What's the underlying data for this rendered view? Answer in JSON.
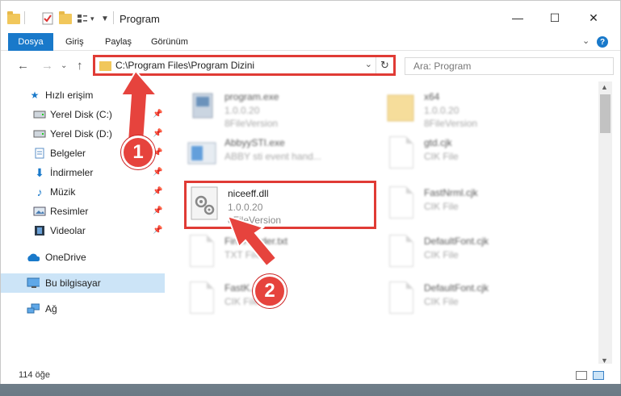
{
  "window": {
    "title": "Program",
    "controls": {
      "minimize": "—",
      "maximize": "☐",
      "close": "✕"
    }
  },
  "ribbon": {
    "tabs": [
      "Dosya",
      "Giriş",
      "Paylaş",
      "Görünüm"
    ],
    "collapse_icon": "chevron-down-icon",
    "help_label": "?"
  },
  "address": {
    "path": "C:\\Program Files\\Program Dizini",
    "search_placeholder": "Ara: Program"
  },
  "sidebar": {
    "items": [
      {
        "label": "Hızlı erişim",
        "icon": "star-icon"
      },
      {
        "label": "Yerel Disk (C:)",
        "icon": "drive-icon",
        "pinned": true
      },
      {
        "label": "Yerel Disk (D:)",
        "icon": "drive-icon",
        "pinned": true
      },
      {
        "label": "Belgeler",
        "icon": "documents-icon",
        "pinned": true
      },
      {
        "label": "İndirmeler",
        "icon": "download-icon",
        "pinned": true
      },
      {
        "label": "Müzik",
        "icon": "music-icon",
        "pinned": true
      },
      {
        "label": "Resimler",
        "icon": "pictures-icon",
        "pinned": true
      },
      {
        "label": "Videolar",
        "icon": "videos-icon",
        "pinned": true
      },
      {
        "label": "OneDrive",
        "icon": "cloud-icon"
      },
      {
        "label": "Bu bilgisayar",
        "icon": "computer-icon",
        "selected": true
      },
      {
        "label": "Ağ",
        "icon": "network-icon"
      }
    ]
  },
  "files": {
    "left": [
      {
        "name": "program.exe",
        "line1": "1.0.0.20",
        "line2": "8FileVersion",
        "blurred": true
      },
      {
        "name": "AbbyySTI.exe",
        "line1": "ABBY sti event hand...",
        "line2": "",
        "blurred": true
      },
      {
        "name": "niceeff.dll",
        "line1": "1.0.0.20",
        "line2": "8FileVersion",
        "blurred": false
      },
      {
        "name": "FineReader.txt",
        "line1": "TXT File",
        "line2": "",
        "blurred": true
      },
      {
        "name": "FastK...",
        "line1": "CIK File",
        "line2": "",
        "blurred": true
      }
    ],
    "right": [
      {
        "name": "x64",
        "line1": "1.0.0.20",
        "line2": "8FileVersion",
        "blurred": true
      },
      {
        "name": "gtd.cjk",
        "line1": "CIK File",
        "line2": "",
        "blurred": true
      },
      {
        "name": "FastNrml.cjk",
        "line1": "CIK File",
        "line2": "",
        "blurred": true
      },
      {
        "name": "DefaultFont.cjk",
        "line1": "CIK File",
        "line2": "",
        "blurred": true
      },
      {
        "name": "DefaultFont.cjk",
        "line1": "CIK File",
        "line2": "",
        "blurred": true
      }
    ]
  },
  "status": {
    "item_count": "114 öğe"
  },
  "callouts": {
    "step1": "1",
    "step2": "2"
  },
  "colors": {
    "accent": "#1979ca",
    "highlight": "#e03b35",
    "selected": "#cce4f7"
  }
}
